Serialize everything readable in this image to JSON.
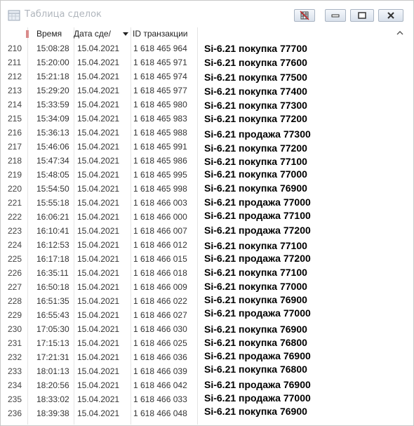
{
  "window": {
    "title": "Таблица сделок"
  },
  "columns": {
    "time": "Время",
    "date": "Дата сде/",
    "id": "ID транзакции"
  },
  "rows": [
    {
      "num": "210",
      "time": "15:08:28",
      "date": "15.04.2021",
      "id": "1 618 465 964",
      "note": "Si-6.21 покупка 77700"
    },
    {
      "num": "211",
      "time": "15:20:00",
      "date": "15.04.2021",
      "id": "1 618 465 971",
      "note": "Si-6.21 покупка 77600"
    },
    {
      "num": "212",
      "time": "15:21:18",
      "date": "15.04.2021",
      "id": "1 618 465 974",
      "note": "Si-6.21 покупка 77500"
    },
    {
      "num": "213",
      "time": "15:29:20",
      "date": "15.04.2021",
      "id": "1 618 465 977",
      "note": "Si-6.21 покупка 77400"
    },
    {
      "num": "214",
      "time": "15:33:59",
      "date": "15.04.2021",
      "id": "1 618 465 980",
      "note": "Si-6.21 покупка 77300"
    },
    {
      "num": "215",
      "time": "15:34:09",
      "date": "15.04.2021",
      "id": "1 618 465 983",
      "note": "Si-6.21 покупка 77200"
    },
    {
      "num": "216",
      "time": "15:36:13",
      "date": "15.04.2021",
      "id": "1 618 465 988",
      "note": "Si-6.21 продажа 77300"
    },
    {
      "num": "217",
      "time": "15:46:06",
      "date": "15.04.2021",
      "id": "1 618 465 991",
      "note": "Si-6.21 покупка 77200"
    },
    {
      "num": "218",
      "time": "15:47:34",
      "date": "15.04.2021",
      "id": "1 618 465 986",
      "note": "Si-6.21 покупка 77100"
    },
    {
      "num": "219",
      "time": "15:48:05",
      "date": "15.04.2021",
      "id": "1 618 465 995",
      "note": "Si-6.21 покупка 77000"
    },
    {
      "num": "220",
      "time": "15:54:50",
      "date": "15.04.2021",
      "id": "1 618 465 998",
      "note": "Si-6.21 покупка 76900"
    },
    {
      "num": "221",
      "time": "15:55:18",
      "date": "15.04.2021",
      "id": "1 618 466 003",
      "note": "Si-6.21 продажа 77000"
    },
    {
      "num": "222",
      "time": "16:06:21",
      "date": "15.04.2021",
      "id": "1 618 466 000",
      "note": "Si-6.21 продажа 77100"
    },
    {
      "num": "223",
      "time": "16:10:41",
      "date": "15.04.2021",
      "id": "1 618 466 007",
      "note": "Si-6.21 продажа 77200"
    },
    {
      "num": "224",
      "time": "16:12:53",
      "date": "15.04.2021",
      "id": "1 618 466 012",
      "note": "Si-6.21 покупка 77100"
    },
    {
      "num": "225",
      "time": "16:17:18",
      "date": "15.04.2021",
      "id": "1 618 466 015",
      "note": "Si-6.21 продажа 77200"
    },
    {
      "num": "226",
      "time": "16:35:11",
      "date": "15.04.2021",
      "id": "1 618 466 018",
      "note": "Si-6.21 покупка 77100"
    },
    {
      "num": "227",
      "time": "16:50:18",
      "date": "15.04.2021",
      "id": "1 618 466 009",
      "note": "Si-6.21 покупка 77000"
    },
    {
      "num": "228",
      "time": "16:51:35",
      "date": "15.04.2021",
      "id": "1 618 466 022",
      "note": "Si-6.21 покупка 76900"
    },
    {
      "num": "229",
      "time": "16:55:43",
      "date": "15.04.2021",
      "id": "1 618 466 027",
      "note": "Si-6.21 продажа 77000"
    },
    {
      "num": "230",
      "time": "17:05:30",
      "date": "15.04.2021",
      "id": "1 618 466 030",
      "note": "Si-6.21 покупка 76900"
    },
    {
      "num": "231",
      "time": "17:15:13",
      "date": "15.04.2021",
      "id": "1 618 466 025",
      "note": "Si-6.21 покупка 76800"
    },
    {
      "num": "232",
      "time": "17:21:31",
      "date": "15.04.2021",
      "id": "1 618 466 036",
      "note": "Si-6.21 продажа 76900"
    },
    {
      "num": "233",
      "time": "18:01:13",
      "date": "15.04.2021",
      "id": "1 618 466 039",
      "note": "Si-6.21 покупка 76800"
    },
    {
      "num": "234",
      "time": "18:20:56",
      "date": "15.04.2021",
      "id": "1 618 466 042",
      "note": "Si-6.21 продажа 76900"
    },
    {
      "num": "235",
      "time": "18:33:02",
      "date": "15.04.2021",
      "id": "1 618 466 033",
      "note": "Si-6.21 продажа 77000"
    },
    {
      "num": "236",
      "time": "18:39:38",
      "date": "15.04.2021",
      "id": "1 618 466 048",
      "note": "Si-6.21 покупка 76900"
    }
  ]
}
